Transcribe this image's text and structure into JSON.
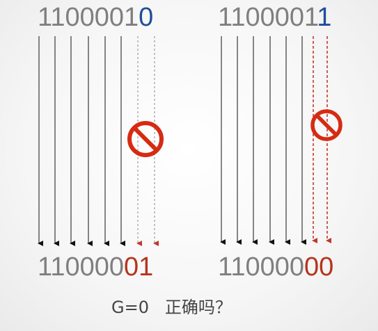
{
  "diagram": {
    "left": {
      "input_prefix": "1100001",
      "input_last": "0",
      "output_prefix": "110000",
      "output_tail": "01"
    },
    "right": {
      "input_prefix": "1100001",
      "input_last": "1",
      "output_prefix": "110000",
      "output_tail": "00"
    },
    "caption": "G=0   正确吗？",
    "colors": {
      "gray_text": "#7f7f7f",
      "blue_bit": "#1f4e9a",
      "red_bit": "#b5341c",
      "arrow_black": "#111111",
      "arrow_red": "#c0392b",
      "no_sign": "#d62b12"
    },
    "icons": [
      "no-entry-sign-icon",
      "no-entry-sign-icon"
    ]
  }
}
